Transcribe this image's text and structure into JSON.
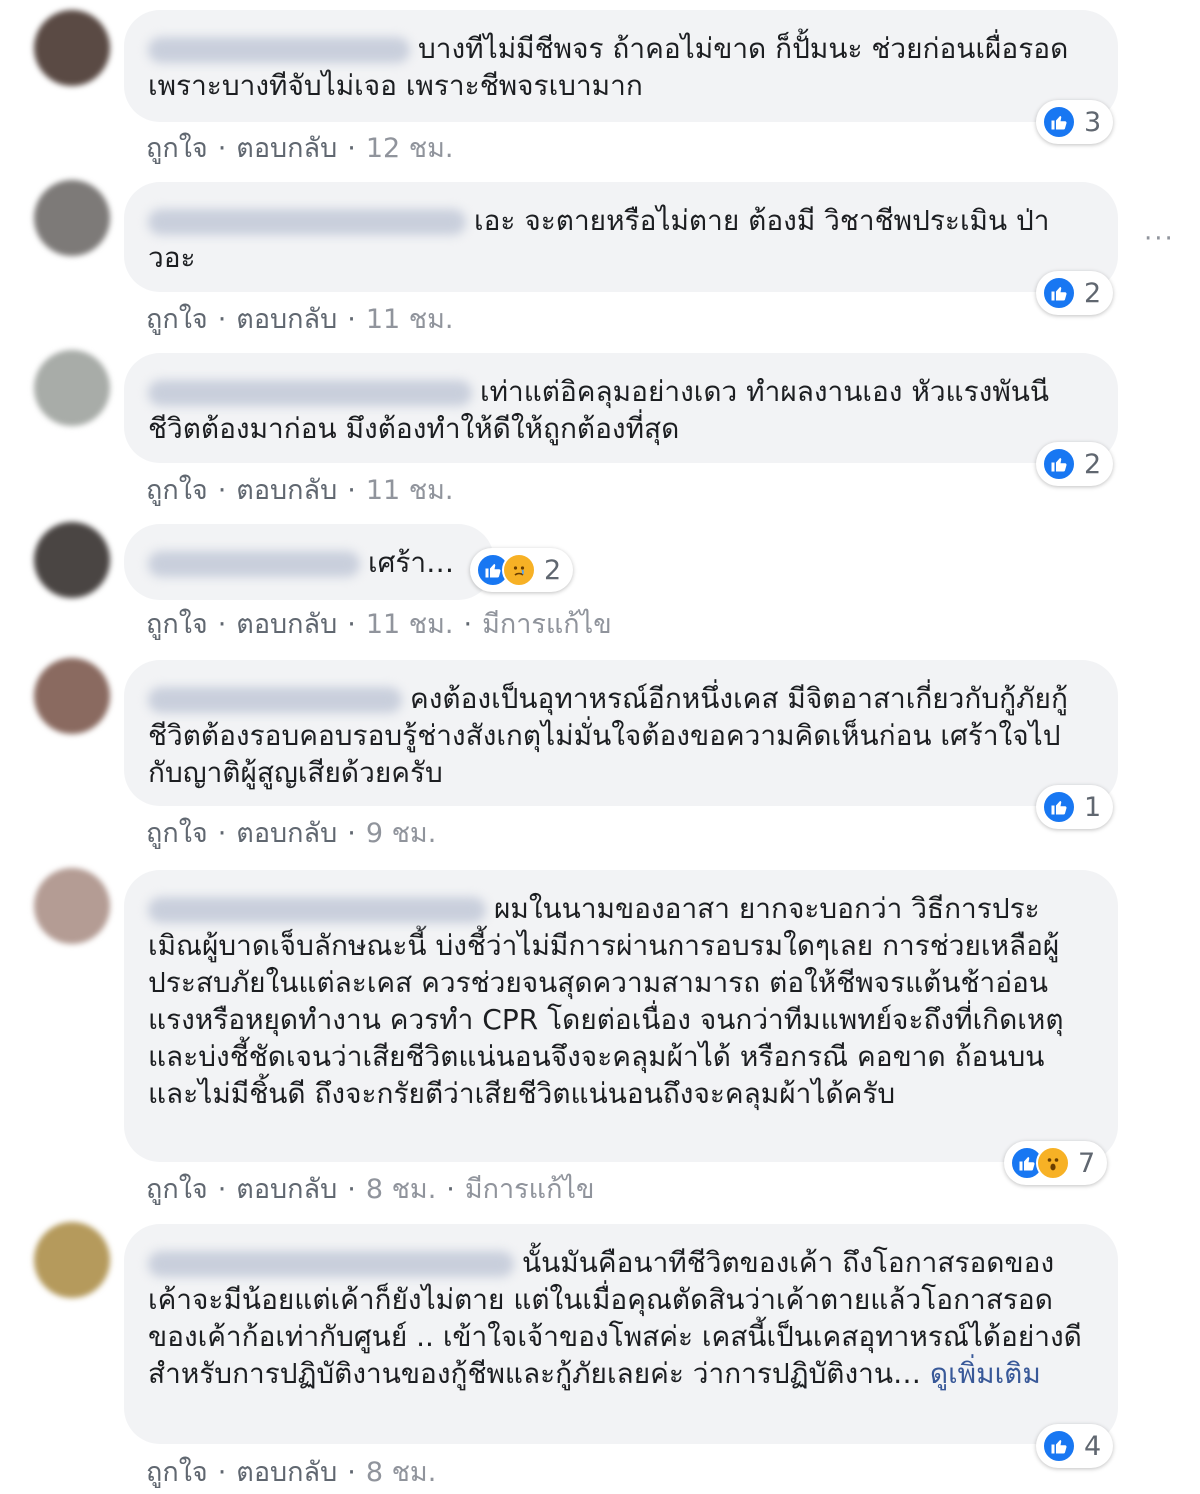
{
  "comments": [
    {
      "text": "บางทีไม่มีชีพจร ถ้าคอไม่ขาด ก็ปั้มนะ ช่วยก่อนเผื่อรอด เพราะบางทีจับไม่เจอ เพราะชีพจรเบามาก",
      "like_label": "ถูกใจ",
      "reply_label": "ตอบกลับ",
      "time": "12 ชม.",
      "reaction_count": "3",
      "avatar_color": "#5a4a44"
    },
    {
      "text": "เอะ จะตายหรือไม่ตาย ต้องมี วิชาชีพประเมิน ป่าวอะ",
      "like_label": "ถูกใจ",
      "reply_label": "ตอบกลับ",
      "time": "11 ชม.",
      "reaction_count": "2",
      "avatar_color": "#7d7a78"
    },
    {
      "text": "เท่าแต่อิคลุมอย่างเดว ทำผลงานเอง หัวแรงพันนี ชีวิตต้องมาก่อน มึงต้องทำให้ดีให้ถูกต้องที่สุด",
      "like_label": "ถูกใจ",
      "reply_label": "ตอบกลับ",
      "time": "11 ชม.",
      "reaction_count": "2",
      "avatar_color": "#a8aca8"
    },
    {
      "text": "เศร้า…",
      "like_label": "ถูกใจ",
      "reply_label": "ตอบกลับ",
      "time": "11 ชม.",
      "edited": "มีการแก้ไข",
      "reaction_count": "2",
      "avatar_color": "#4a4543"
    },
    {
      "text": "คงต้องเป็นอุทาหรณ์อีกหนึ่งเคส มีจิตอาสาเกี่ยวกับกู้ภัยกู้ชีวิตต้องรอบคอบรอบรู้ช่างสังเกตุไม่มั่นใจต้องขอความคิดเห็นก่อน เศร้าใจไปกับญาติผู้สูญเสียด้วยครับ",
      "like_label": "ถูกใจ",
      "reply_label": "ตอบกลับ",
      "time": "9 ชม.",
      "reaction_count": "1",
      "avatar_color": "#8a6a60"
    },
    {
      "text": "ผมในนามของอาสา ยากจะบอกว่า วิธีการประเมิณผู้บาดเจ็บลักษณะนี้ บ่งชี้ว่าไม่มีการผ่านการอบรมใดๆเลย การช่วยเหลือผู้ประสบภัยในแต่ละเคส ควรช่วยจนสุดความสามารถ ต่อให้ชีพจรแต้นช้าอ่อนแรงหรือหยุดทำงาน ควรทำ CPR โดยต่อเนื่อง จนกว่าทีมแพทย์จะถึงที่เกิดเหตุและบ่งชี้ชัดเจนว่าเสียชีวิตแน่นอนจึงจะคลุมผ้าได้ หรือกรณี คอขาด ถ้อนบนและไม่มีชิ้นดี ถึงจะกรัยตีว่าเสียชีวิตแน่นอนถึงจะคลุมผ้าได้ครับ",
      "like_label": "ถูกใจ",
      "reply_label": "ตอบกลับ",
      "time": "8 ชม.",
      "edited": "มีการแก้ไข",
      "reaction_count": "7",
      "avatar_color": "#b49c94"
    },
    {
      "text": "นั้นมันคือนาทีชีวิตของเค้า ถึงโอกาสรอดของเค้าจะมีน้อยแต่เค้าก็ยังไม่ตาย แต่ในเมื่อคุณตัดสินว่าเค้าตายแล้วโอกาสรอดของเค้าก้อเท่ากับศูนย์ .. เข้าใจเจ้าของโพสค่ะ เคสนี้เป็นเคสอุทาหรณ์ได้อย่างดีสำหรับการปฏิบัติงานของกู้ชีพและกู้ภัยเลยค่ะ ว่าการปฏิบัติงาน…",
      "see_more": "ดูเพิ่มเติม",
      "like_label": "ถูกใจ",
      "reply_label": "ตอบกลับ",
      "time": "8 ชม.",
      "reaction_count": "4",
      "avatar_color": "#b59a5c"
    }
  ],
  "more_menu": "···",
  "colors": {
    "bubble": "#f2f3f5",
    "like_blue": "#1877f2",
    "link": "#385898",
    "meta_gray": "#90949c"
  }
}
